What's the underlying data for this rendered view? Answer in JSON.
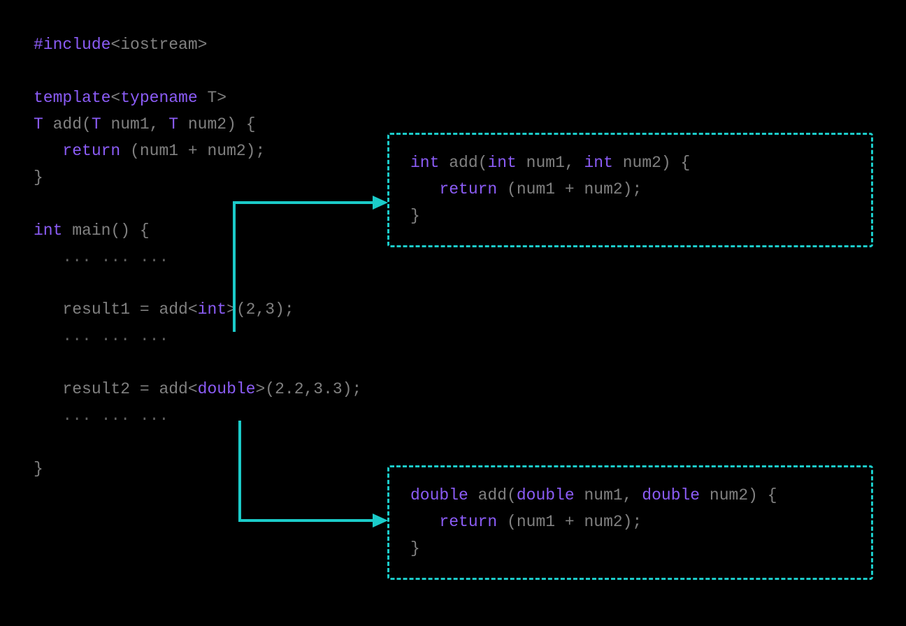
{
  "code": {
    "include_hash": "#include",
    "include_header": "<iostream>",
    "template_kw": "template",
    "typename_kw": "typename",
    "t_param": "T",
    "add_fn": " add(",
    "num1": " num1, ",
    "num2": " num2) {",
    "return_kw": "return",
    "return_body": " (num1 + num2);",
    "close_brace": "}",
    "int_kw": "int",
    "main_sig": " main() {",
    "ellipsis": "... ... ...",
    "result1": "result1 = add<",
    "int_type": "int",
    "call_int_args": ">(2,3);",
    "result2": "result2 = add<",
    "double_type": "double",
    "call_double_args": ">(2.2,3.3);",
    "indent": "   "
  },
  "box_int": {
    "ret": "int",
    "sig1": " add(",
    "p1t": "int",
    "p1n": " num1, ",
    "p2t": "int",
    "p2n": " num2) {",
    "ret_kw": "return",
    "ret_body": " (num1 + num2);",
    "close": "}",
    "indent": "   "
  },
  "box_double": {
    "ret": "double",
    "sig1": " add(",
    "p1t": "double",
    "p1n": " num1, ",
    "p2t": "double",
    "p2n": " num2) {",
    "ret_kw": "return",
    "ret_body": " (num1 + num2);",
    "close": "}",
    "indent": "   "
  }
}
